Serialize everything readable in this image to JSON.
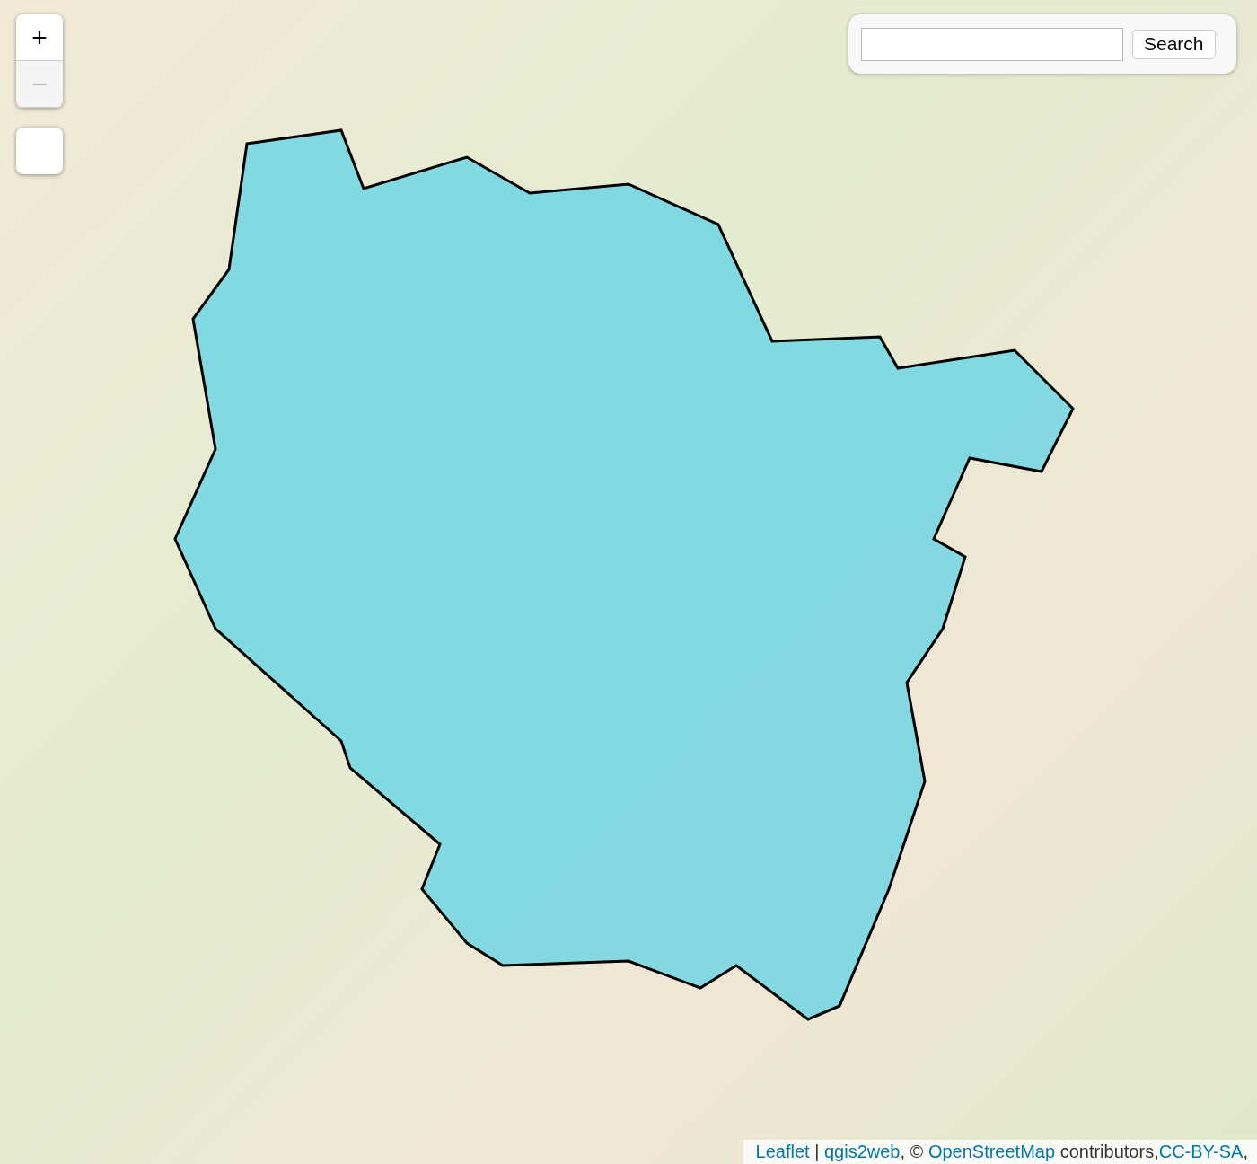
{
  "zoom_controls": [
    {
      "label": "+",
      "disabled": false
    },
    {
      "label": "−",
      "disabled": true
    }
  ],
  "search": {
    "button": "Search"
  },
  "attribution": [
    {
      "kind": "link",
      "text": "Leaflet"
    },
    {
      "kind": "text",
      "text": " | "
    },
    {
      "kind": "link",
      "text": "qgis2web"
    },
    {
      "kind": "text",
      "text": ", © "
    },
    {
      "kind": "link",
      "text": "OpenStreetMap"
    },
    {
      "kind": "text",
      "text": " contributors,"
    },
    {
      "kind": "link",
      "text": "CC-BY-SA"
    },
    {
      "kind": "text",
      "text": ","
    }
  ]
}
